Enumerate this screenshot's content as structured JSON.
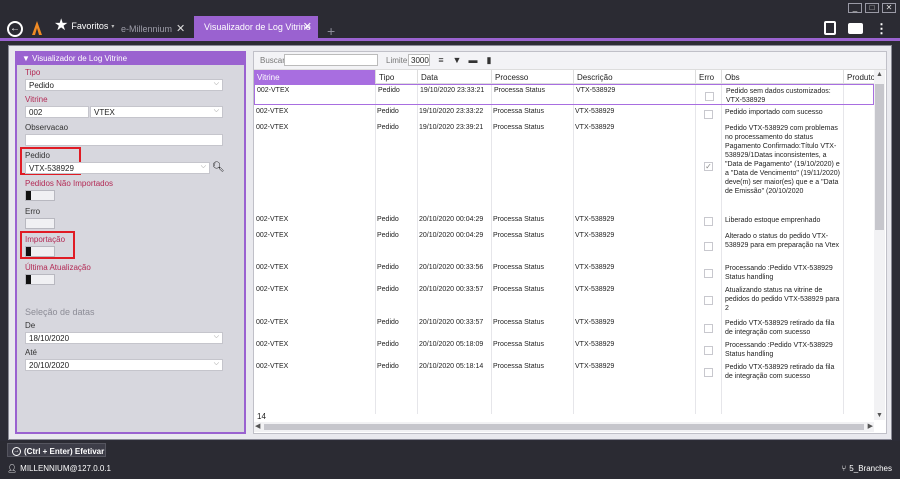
{
  "topbar": {
    "favorites_label": "Favoritos",
    "favorites_caret": "▾",
    "tabs": [
      {
        "label": "e-Millennium",
        "close": "✕"
      },
      {
        "label": "Visualizador de Log Vitrine",
        "close": "✕"
      }
    ],
    "add_tab": "+",
    "window_controls": [
      "_",
      "□",
      "✕"
    ]
  },
  "left": {
    "header": "▼ Visualizador de Log Vitrine",
    "tipo_label": "Tipo",
    "tipo_value": "Pedido",
    "vitrine_label": "Vitrine",
    "vitrine_code": "002",
    "vitrine_name": "VTEX",
    "observacao_label": "Observacao",
    "observacao_value": "",
    "pedido_label": "Pedido",
    "pedido_value": "VTX-538929",
    "pedidos_nao_importados_label": "Pedidos Não Importados",
    "erro_label": "Erro",
    "importacao_label": "Importação",
    "ultima_atualizacao_label": "Última Atualização",
    "selecao_label": "Seleção de datas",
    "de_label": "De",
    "de_value": "18/10/2020",
    "ate_label": "Até",
    "ate_value": "20/10/2020",
    "dropdown_glyph": "⌵"
  },
  "toolbar": {
    "buscar_label": "Buscar",
    "buscar_value": "",
    "limite_label": "Limite",
    "limite_value": "3000"
  },
  "table": {
    "columns": [
      "Vitrine",
      "Tipo",
      "Data",
      "Processo",
      "Descrição",
      "Erro",
      "Obs",
      "Produto"
    ],
    "rows": [
      {
        "vitrine": "002-VTEX",
        "tipo": "Pedido",
        "data": "19/10/2020 23:33:21",
        "processo": "Processa Status",
        "descricao": "VTX-538929",
        "erro": "",
        "obs": "Pedido sem dados customizados: VTX-538929"
      },
      {
        "vitrine": "002-VTEX",
        "tipo": "Pedido",
        "data": "19/10/2020 23:33:22",
        "processo": "Processa Status",
        "descricao": "VTX-538929",
        "erro": "",
        "obs": "Pedido importado com sucesso"
      },
      {
        "vitrine": "002-VTEX",
        "tipo": "Pedido",
        "data": "19/10/2020 23:39:21",
        "processo": "Processa Status",
        "descricao": "VTX-538929",
        "erro": "✓",
        "obs": "Pedido VTX-538929 com problemas no processamento do status Pagamento Confirmado:Título VTX-538929/1Datas inconsistentes, a \"Data de Pagamento\" (19/10/2020) e a \"Data de Vencimento\" (19/11/2020) deve(m) ser maior(es) que e a \"Data de Emissão\" (20/10/2020"
      },
      {
        "vitrine": "002-VTEX",
        "tipo": "Pedido",
        "data": "20/10/2020 00:04:29",
        "processo": "Processa Status",
        "descricao": "VTX-538929",
        "erro": "",
        "obs": "Liberado estoque emprenhado"
      },
      {
        "vitrine": "002-VTEX",
        "tipo": "Pedido",
        "data": "20/10/2020 00:04:29",
        "processo": "Processa Status",
        "descricao": "VTX-538929",
        "erro": "",
        "obs": "Alterado o status do pedido VTX-538929 para em preparação na Vtex"
      },
      {
        "vitrine": "002-VTEX",
        "tipo": "Pedido",
        "data": "20/10/2020 00:33:56",
        "processo": "Processa Status",
        "descricao": "VTX-538929",
        "erro": "",
        "obs": "Processando :Pedido VTX-538929 Status handling"
      },
      {
        "vitrine": "002-VTEX",
        "tipo": "Pedido",
        "data": "20/10/2020 00:33:57",
        "processo": "Processa Status",
        "descricao": "VTX-538929",
        "erro": "",
        "obs": "Atualizando status na vitrine de pedidos do pedido VTX-538929 para 2"
      },
      {
        "vitrine": "002-VTEX",
        "tipo": "Pedido",
        "data": "20/10/2020 00:33:57",
        "processo": "Processa Status",
        "descricao": "VTX-538929",
        "erro": "",
        "obs": "Pedido VTX-538929 retirado da fila de integração com sucesso"
      },
      {
        "vitrine": "002-VTEX",
        "tipo": "Pedido",
        "data": "20/10/2020 05:18:09",
        "processo": "Processa Status",
        "descricao": "VTX-538929",
        "erro": "",
        "obs": "Processando :Pedido VTX-538929 Status handling"
      },
      {
        "vitrine": "002-VTEX",
        "tipo": "Pedido",
        "data": "20/10/2020 05:18:14",
        "processo": "Processa Status",
        "descricao": "VTX-538929",
        "erro": "",
        "obs": "Pedido VTX-538929 retirado da fila de integração com sucesso"
      }
    ],
    "count": "14"
  },
  "bottom": {
    "efetivar_label": "(Ctrl + Enter) Efetivar",
    "user": "MILLENNIUM@127.0.0.1",
    "branch": "5_Branches"
  },
  "colors": {
    "accent": "#9a62d0",
    "header_active": "#a86ee0",
    "highlight_box": "#e01b24",
    "label_red": "#b32a55",
    "chrome": "#2b2b33"
  }
}
